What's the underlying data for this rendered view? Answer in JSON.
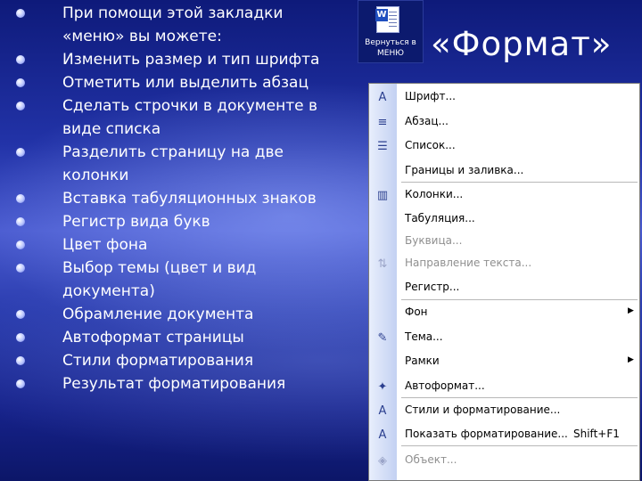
{
  "bullets": [
    [
      "При помощи этой закладки",
      "«меню» вы можете:"
    ],
    [
      "Изменить размер и тип шрифта"
    ],
    [
      "Отметить или выделить абзац"
    ],
    [
      "Сделать строчки в документе в",
      "виде списка"
    ],
    [
      "Разделить страницу на две",
      "колонки"
    ],
    [
      "Вставка табуляционных знаков"
    ],
    [
      "Регистр вида букв"
    ],
    [
      "Цвет фона"
    ],
    [
      "Выбор темы (цвет и вид",
      "документа)"
    ],
    [
      "Обрамление документа"
    ],
    [
      "Автоформат страницы"
    ],
    [
      "Стили форматирования"
    ],
    [
      "Результат форматирования"
    ]
  ],
  "back_button": {
    "icon": "word-document-icon",
    "label": "Вернуться в МЕНЮ"
  },
  "title": "«Формат»",
  "menu": {
    "items": [
      {
        "label": "Шрифт...",
        "icon": "font-icon",
        "icon_glyph": "A",
        "shortcut": "",
        "submenu": false,
        "disabled": false
      },
      {
        "label": "Абзац...",
        "icon": "paragraph-icon",
        "icon_glyph": "≡",
        "shortcut": "",
        "submenu": false,
        "disabled": false
      },
      {
        "label": "Список...",
        "icon": "list-icon",
        "icon_glyph": "☰",
        "shortcut": "",
        "submenu": false,
        "disabled": false
      },
      {
        "label": "Границы и заливка...",
        "icon": "",
        "icon_glyph": "",
        "shortcut": "",
        "submenu": false,
        "disabled": false
      },
      {
        "label": "Колонки...",
        "icon": "columns-icon",
        "icon_glyph": "▥",
        "shortcut": "",
        "submenu": false,
        "disabled": false
      },
      {
        "label": "Табуляция...",
        "icon": "",
        "icon_glyph": "",
        "shortcut": "",
        "submenu": false,
        "disabled": false
      },
      {
        "label": "Буквица...",
        "icon": "",
        "icon_glyph": "",
        "shortcut": "",
        "submenu": false,
        "disabled": true
      },
      {
        "label": "Направление текста...",
        "icon": "text-direction-icon",
        "icon_glyph": "⇅",
        "shortcut": "",
        "submenu": false,
        "disabled": true
      },
      {
        "label": "Регистр...",
        "icon": "",
        "icon_glyph": "",
        "shortcut": "",
        "submenu": false,
        "disabled": false
      },
      {
        "label": "Фон",
        "icon": "",
        "icon_glyph": "",
        "shortcut": "",
        "submenu": true,
        "disabled": false
      },
      {
        "label": "Тема...",
        "icon": "theme-icon",
        "icon_glyph": "✎",
        "shortcut": "",
        "submenu": false,
        "disabled": false
      },
      {
        "label": "Рамки",
        "icon": "",
        "icon_glyph": "",
        "shortcut": "",
        "submenu": true,
        "disabled": false
      },
      {
        "label": "Автоформат...",
        "icon": "autoformat-icon",
        "icon_glyph": "✦",
        "shortcut": "",
        "submenu": false,
        "disabled": false
      },
      {
        "label": "Стили и форматирование...",
        "icon": "styles-icon",
        "icon_glyph": "A",
        "shortcut": "",
        "submenu": false,
        "disabled": false
      },
      {
        "label": "Показать форматирование...",
        "icon": "reveal-formatting-icon",
        "icon_glyph": "A",
        "shortcut": "Shift+F1",
        "submenu": false,
        "disabled": false
      },
      {
        "label": "Объект...",
        "icon": "object-icon",
        "icon_glyph": "◈",
        "shortcut": "",
        "submenu": false,
        "disabled": true
      }
    ]
  }
}
